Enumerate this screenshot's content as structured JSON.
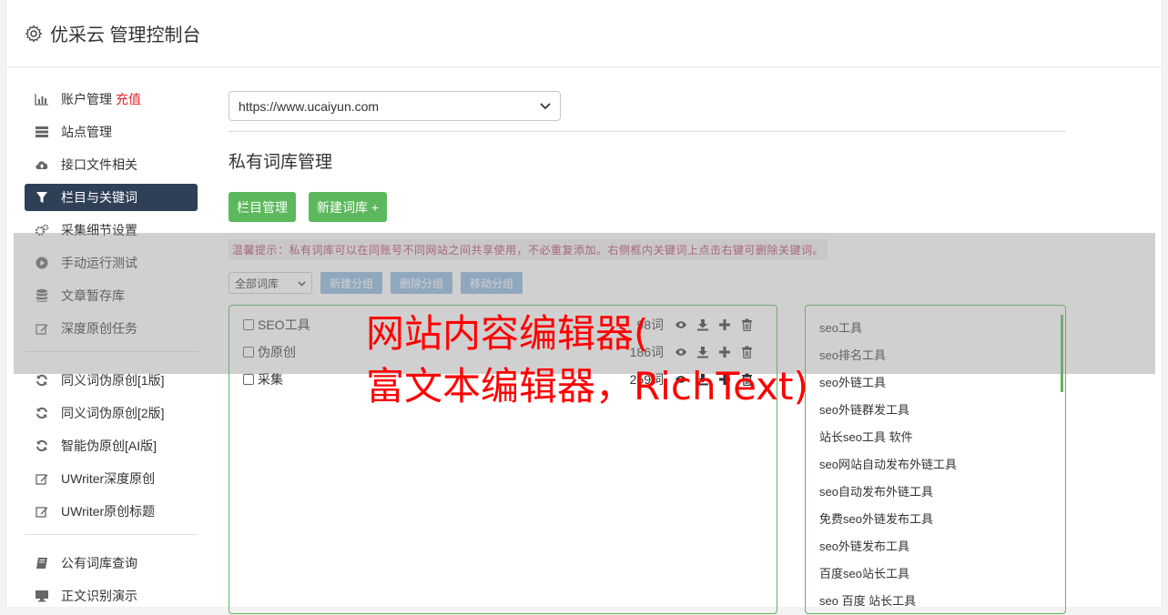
{
  "header": {
    "title": "优采云 管理控制台"
  },
  "sidebar": {
    "items": [
      {
        "label": "账户管理",
        "badge": "充值",
        "icon": "bar-chart-icon"
      },
      {
        "label": "站点管理",
        "icon": "server-icon"
      },
      {
        "label": "接口文件相关",
        "icon": "cloud-upload-icon"
      },
      {
        "label": "栏目与关键词",
        "icon": "filter-icon",
        "active": true
      },
      {
        "label": "采集细节设置",
        "icon": "cogs-icon"
      },
      {
        "label": "手动运行测试",
        "icon": "play-circle-icon"
      },
      {
        "label": "文章暂存库",
        "icon": "database-icon"
      },
      {
        "label": "深度原创任务",
        "icon": "edit-icon"
      }
    ],
    "group2": [
      {
        "label": "同义词伪原创[1版]",
        "icon": "refresh-icon"
      },
      {
        "label": "同义词伪原创[2版]",
        "icon": "refresh-icon"
      },
      {
        "label": "智能伪原创[AI版]",
        "icon": "refresh-icon"
      },
      {
        "label": "UWriter深度原创",
        "icon": "edit-icon"
      },
      {
        "label": "UWriter原创标题",
        "icon": "edit-icon"
      }
    ],
    "group3": [
      {
        "label": "公有词库查询",
        "icon": "book-icon"
      },
      {
        "label": "正文识别演示",
        "icon": "monitor-icon"
      }
    ]
  },
  "main": {
    "site_select": "https://www.ucaiyun.com",
    "page_title": "私有词库管理",
    "buttons": {
      "column_manage": "栏目管理",
      "new_library": "新建词库 +"
    },
    "tip": "温馨提示：私有词库可以在同账号不同网站之间共享使用，不必重复添加。右侧框内关键词上点击右键可删除关键词。",
    "filter_select": "全部词库",
    "group_buttons": {
      "new_group": "新建分组",
      "delete_group": "删除分组",
      "move_group": "移动分组"
    },
    "libraries": [
      {
        "name": "SEO工具",
        "count": "98词"
      },
      {
        "name": "伪原创",
        "count": "186词"
      },
      {
        "name": "采集",
        "count": "259词"
      }
    ],
    "keywords": [
      "seo工具",
      "seo排名工具",
      "seo外链工具",
      "seo外链群发工具",
      "站长seo工具 软件",
      "seo网站自动发布外链工具",
      "seo自动发布外链工具",
      "免费seo外链发布工具",
      "seo外链发布工具",
      "百度seo站长工具",
      "seo 百度 站长工具"
    ]
  },
  "overlay": {
    "line1": "网站内容编辑器(",
    "line2": "富文本编辑器，RichText)"
  }
}
